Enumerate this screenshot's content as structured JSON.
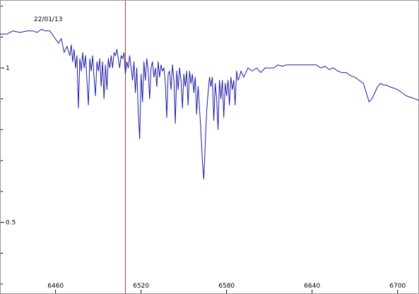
{
  "chart_data": {
    "type": "line",
    "title": "",
    "annotation": "22/01/13",
    "xlabel": "",
    "ylabel": "",
    "xlim": [
      6421,
      6715
    ],
    "ylim": [
      0.268,
      1.22
    ],
    "x_ticks": [
      {
        "value": 6460,
        "label": "6460"
      },
      {
        "value": 6520,
        "label": "6520"
      },
      {
        "value": 6580,
        "label": "6580"
      },
      {
        "value": 6640,
        "label": "6640"
      },
      {
        "value": 6700,
        "label": "6700"
      }
    ],
    "y_ticks": [
      {
        "value": 1.0,
        "label": "1"
      },
      {
        "value": 0.5,
        "label": "0.5"
      }
    ],
    "y_minor_ticks": [
      0.3,
      0.4,
      0.6,
      0.7,
      0.8,
      0.9,
      1.1,
      1.2
    ],
    "grid": false,
    "marker_line_x": 6509,
    "series": [
      {
        "color": "#1a1aa8",
        "marker_color": "#c83030",
        "x": [
          6421,
          6426,
          6430,
          6435,
          6440,
          6444,
          6447,
          6450,
          6453,
          6456,
          6459,
          6462,
          6464,
          6466,
          6468,
          6470,
          6471,
          6472,
          6473,
          6474,
          6475,
          6476,
          6477,
          6478,
          6479,
          6480,
          6481,
          6482,
          6483,
          6484,
          6485,
          6486,
          6487,
          6488,
          6489,
          6490,
          6491,
          6492,
          6493,
          6494,
          6495,
          6496,
          6497,
          6498,
          6499,
          6500,
          6501,
          6502,
          6503,
          6504,
          6505,
          6506,
          6507,
          6508,
          6509,
          6510,
          6511,
          6512,
          6513,
          6514,
          6515,
          6516,
          6517,
          6518,
          6519,
          6520,
          6521,
          6522,
          6523,
          6524,
          6525,
          6526,
          6527,
          6528,
          6529,
          6530,
          6531,
          6532,
          6533,
          6534,
          6535,
          6536,
          6537,
          6538,
          6539,
          6540,
          6541,
          6542,
          6543,
          6544,
          6545,
          6546,
          6547,
          6548,
          6549,
          6550,
          6551,
          6552,
          6553,
          6554,
          6555,
          6556,
          6557,
          6558,
          6559,
          6560,
          6561,
          6562,
          6563,
          6564,
          6565,
          6566,
          6567,
          6568,
          6569,
          6570,
          6571,
          6572,
          6573,
          6574,
          6575,
          6576,
          6577,
          6578,
          6579,
          6580,
          6581,
          6582,
          6583,
          6584,
          6585,
          6586,
          6587,
          6588,
          6589,
          6590,
          6592,
          6595,
          6598,
          6601,
          6604,
          6607,
          6610,
          6613,
          6616,
          6619,
          6622,
          6625,
          6628,
          6631,
          6634,
          6637,
          6640,
          6643,
          6646,
          6649,
          6652,
          6655,
          6658,
          6661,
          6664,
          6667,
          6670,
          6673,
          6676,
          6678,
          6680,
          6682,
          6684,
          6686,
          6688,
          6690,
          6692,
          6694,
          6697,
          6700,
          6703,
          6706,
          6709,
          6712,
          6715
        ],
        "y": [
          1.11,
          1.11,
          1.12,
          1.115,
          1.12,
          1.12,
          1.115,
          1.125,
          1.12,
          1.12,
          1.1,
          1.08,
          1.095,
          1.05,
          1.07,
          1.04,
          1.075,
          1.02,
          1.06,
          1.0,
          1.04,
          0.87,
          1.03,
          0.99,
          1.05,
          1.0,
          1.04,
          0.96,
          0.88,
          1.03,
          0.99,
          1.04,
          0.97,
          0.91,
          1.02,
          0.99,
          1.03,
          0.94,
          1.02,
          0.9,
          1.01,
          0.93,
          1.03,
          1.0,
          1.04,
          1.0,
          1.05,
          1.04,
          1.06,
          1.03,
          1.0,
          1.04,
          1.03,
          1.05,
          0.98,
          1.02,
          1.0,
          1.04,
          1.0,
          0.96,
          1.02,
          0.92,
          1.0,
          0.86,
          0.77,
          0.98,
          0.89,
          1.02,
          0.96,
          1.03,
          0.99,
          0.9,
          1.0,
          1.02,
          0.97,
          1.0,
          0.94,
          1.02,
          0.97,
          1.01,
          0.99,
          1.0,
          0.95,
          0.84,
          0.98,
          0.99,
          0.93,
          1.01,
          0.96,
          0.82,
          0.99,
          0.93,
          1.0,
          0.96,
          0.87,
          0.98,
          0.94,
          0.99,
          0.88,
          0.99,
          0.95,
          0.98,
          0.92,
          0.97,
          0.85,
          0.94,
          0.87,
          0.79,
          0.7,
          0.64,
          0.75,
          0.86,
          0.92,
          0.97,
          0.94,
          0.97,
          0.83,
          0.95,
          0.9,
          0.8,
          0.96,
          0.9,
          0.96,
          0.84,
          0.95,
          0.91,
          0.96,
          0.88,
          0.97,
          0.93,
          0.96,
          0.88,
          0.99,
          0.96,
          0.97,
          0.99,
          0.97,
          1.0,
          0.99,
          1.0,
          0.985,
          1.0,
          1.0,
          1.0,
          1.01,
          1.005,
          1.01,
          1.01,
          1.01,
          1.01,
          1.01,
          1.01,
          1.01,
          1.01,
          1.0,
          1.005,
          0.995,
          1.0,
          0.99,
          0.985,
          0.985,
          0.975,
          0.97,
          0.96,
          0.95,
          0.92,
          0.89,
          0.9,
          0.92,
          0.94,
          0.95,
          0.945,
          0.945,
          0.94,
          0.935,
          0.93,
          0.92,
          0.91,
          0.905,
          0.9,
          0.895
        ]
      }
    ]
  }
}
